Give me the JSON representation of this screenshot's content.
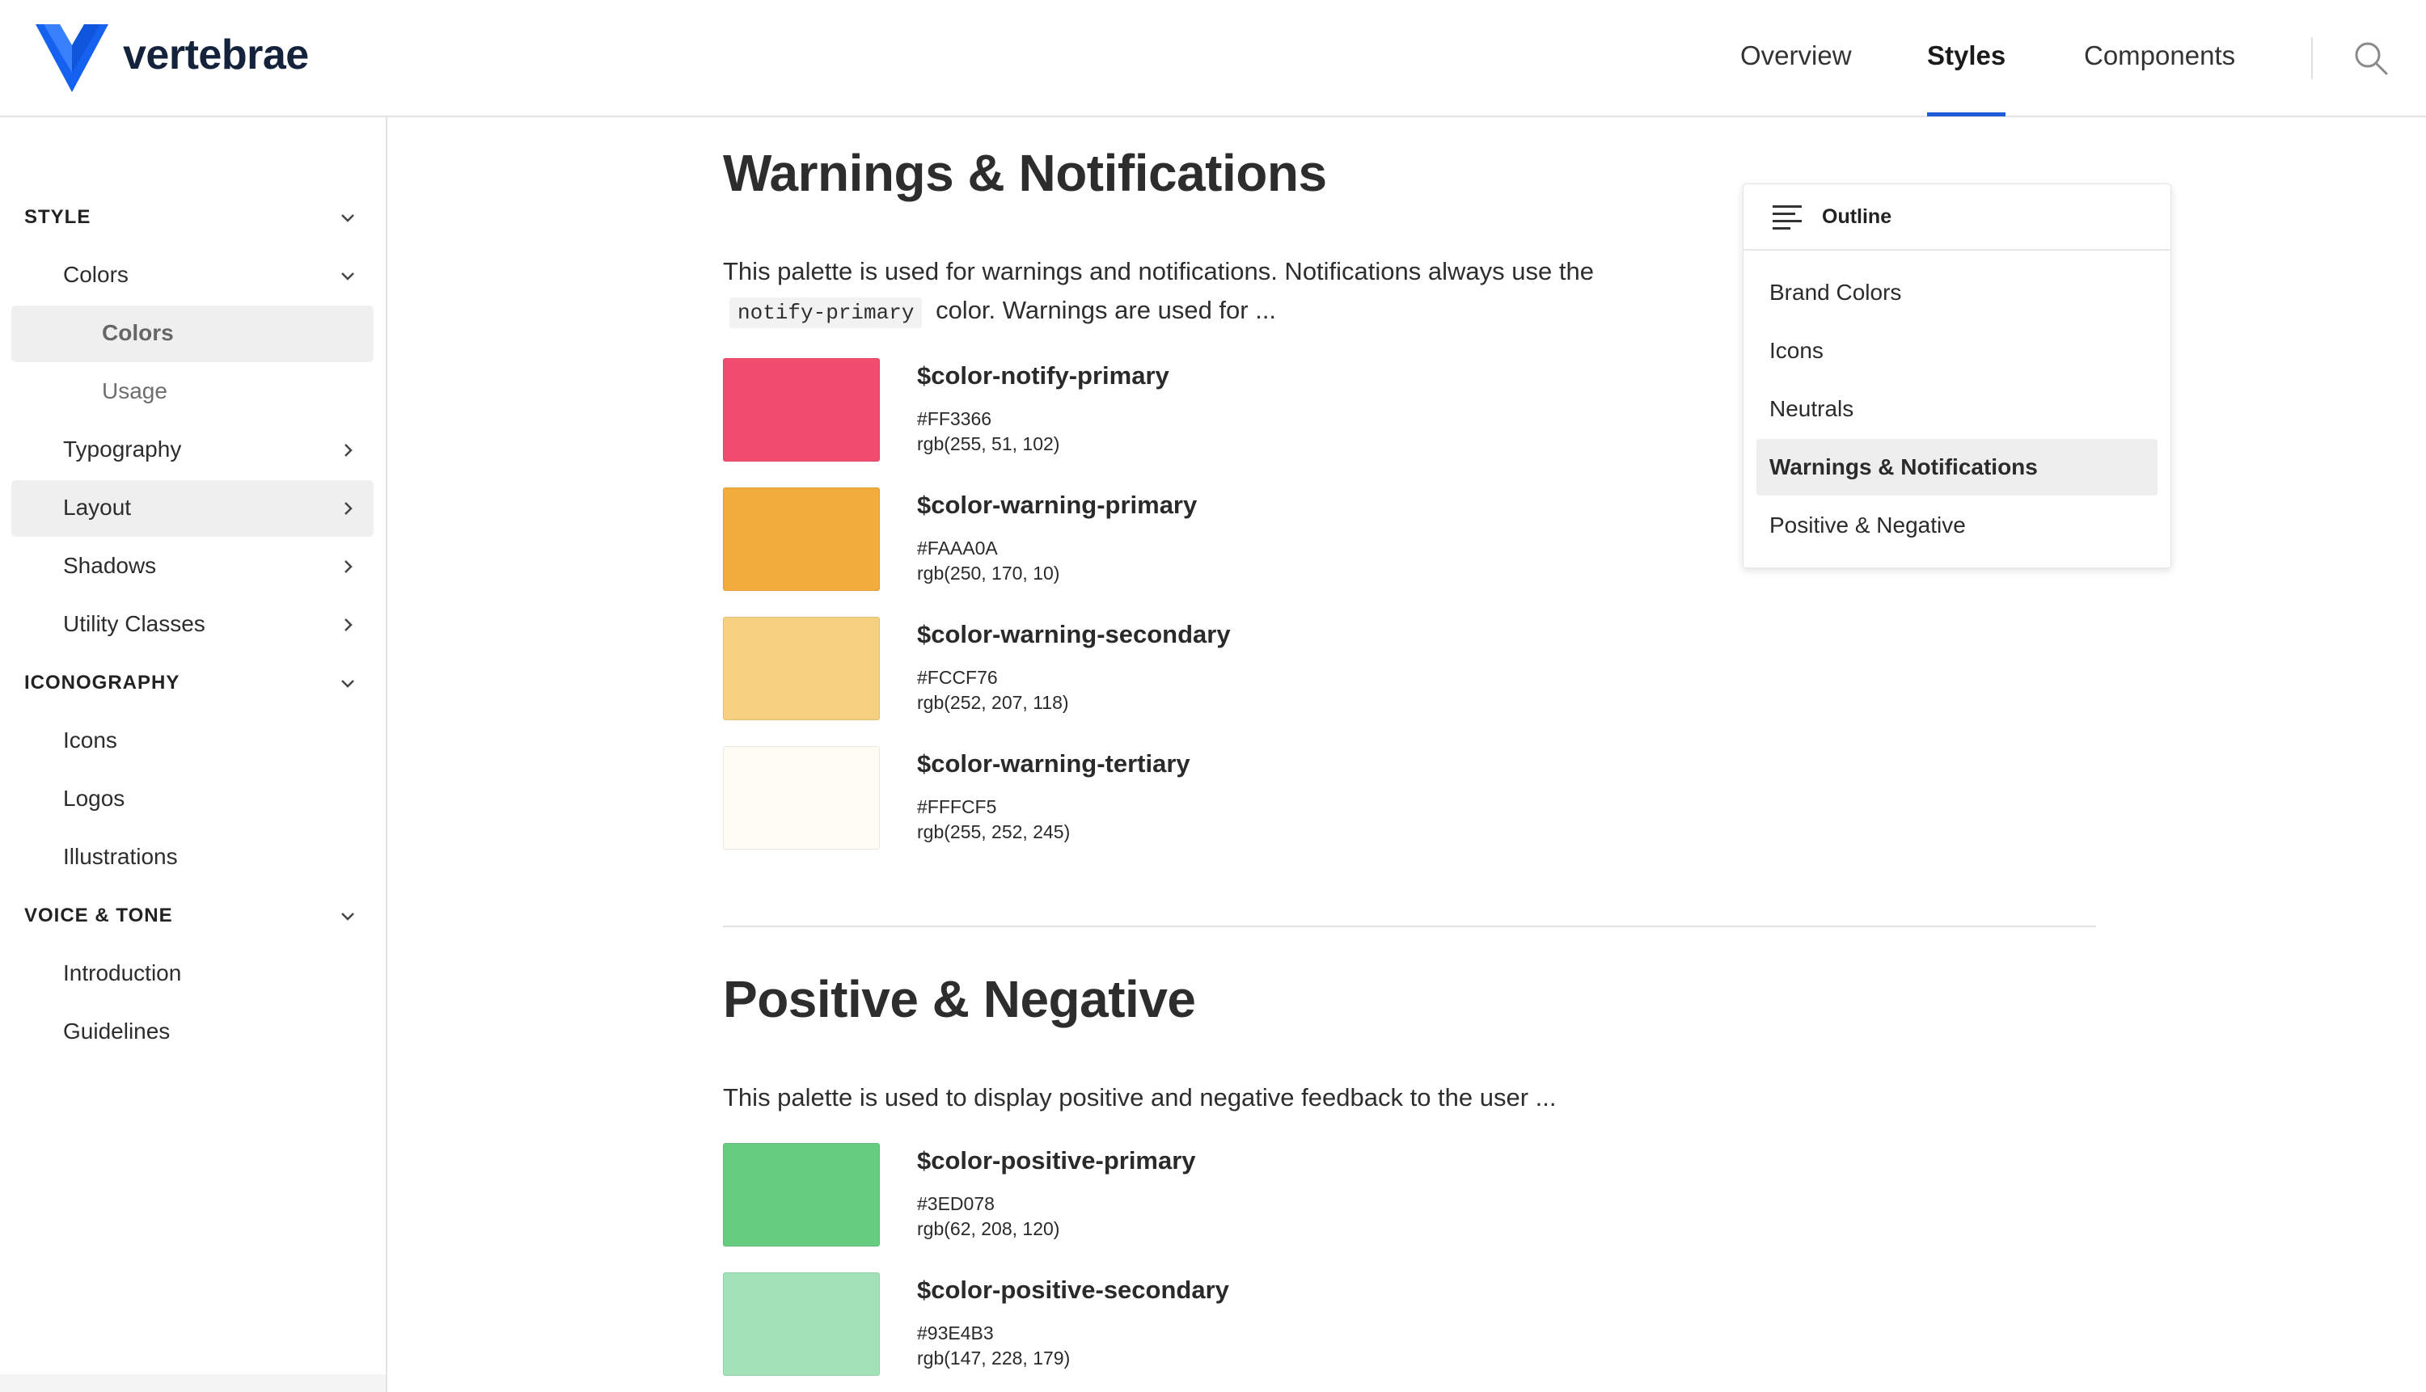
{
  "header": {
    "brand": "vertebrae",
    "nav": [
      {
        "label": "Overview"
      },
      {
        "label": "Styles",
        "active": true
      },
      {
        "label": "Components"
      }
    ],
    "icons": {
      "search": "search-icon",
      "logo": "vertebrae-logo"
    },
    "accent_color": "#1E5BD8"
  },
  "sidebar": {
    "style_section": "STYLE",
    "colors": "Colors",
    "colors_sub": [
      "Colors",
      "Usage"
    ],
    "typography": "Typography",
    "layout": "Layout",
    "shadows": "Shadows",
    "utility_classes": "Utility Classes",
    "iconography_section": "ICONOGRAPHY",
    "icons": "Icons",
    "logos": "Logos",
    "illustrations": "Illustrations",
    "voice_section": "VOICE & TONE",
    "introduction": "Introduction",
    "guidelines": "Guidelines"
  },
  "main": {
    "warnings": {
      "title": "Warnings & Notifications",
      "desc_before": "This palette is used for warnings and notifications. Notifications always use the",
      "desc_code": "notify-primary",
      "desc_after": "color. Warnings are used for ...",
      "swatches": [
        {
          "name": "$color-notify-primary",
          "hex": "#FF3366",
          "rgb": "rgb(255, 51, 102)",
          "color": "#F24C6E"
        },
        {
          "name": "$color-warning-primary",
          "hex": "#FAAA0A",
          "rgb": "rgb(250, 170, 10)",
          "color": "#F2AC3C"
        },
        {
          "name": "$color-warning-secondary",
          "hex": "#FCCF76",
          "rgb": "rgb(252, 207, 118)",
          "color": "#F6D081"
        },
        {
          "name": "$color-warning-tertiary",
          "hex": "#FFFCF5",
          "rgb": "rgb(255, 252, 245)",
          "color": "#FFFCF5"
        }
      ]
    },
    "positive": {
      "title": "Positive & Negative",
      "desc": "This palette is used to display positive and negative feedback to the user ...",
      "swatches": [
        {
          "name": "$color-positive-primary",
          "hex": "#3ED078",
          "rgb": "rgb(62, 208, 120)",
          "color": "#65CC80"
        },
        {
          "name": "$color-positive-secondary",
          "hex": "#93E4B3",
          "rgb": "rgb(147, 228, 179)",
          "color": "#A2E2B8"
        }
      ]
    }
  },
  "outline": {
    "title": "Outline",
    "items": [
      {
        "label": "Brand Colors"
      },
      {
        "label": "Icons"
      },
      {
        "label": "Neutrals"
      },
      {
        "label": "Warnings & Notifications",
        "active": true
      },
      {
        "label": "Positive & Negative"
      }
    ]
  }
}
